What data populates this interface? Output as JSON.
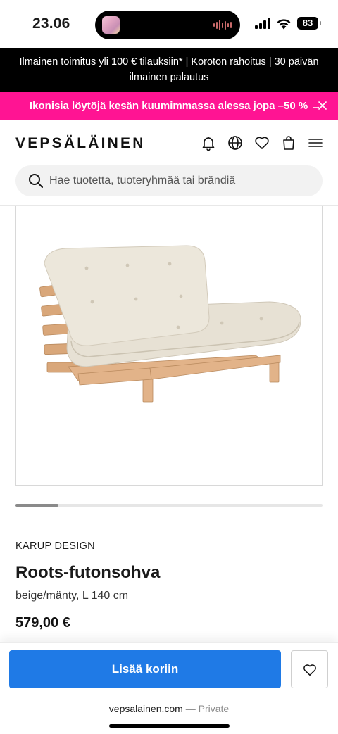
{
  "status_bar": {
    "time": "23.06",
    "battery": "83"
  },
  "promo": {
    "shipping_text": "Ilmainen toimitus yli 100 € tilauksiin* | Koroton rahoitus | 30 päivän ilmainen palautus",
    "sale_text": "Ikonisia löytöjä kesän kuumimmassa alessa jopa –50 % →",
    "sale_color": "#ff1493"
  },
  "header": {
    "logo": "VEPSÄLÄINEN",
    "icons": [
      "bell-icon",
      "globe-icon",
      "heart-icon",
      "shopping-bag-icon",
      "menu-icon"
    ],
    "search_placeholder": "Hae tuotetta, tuoteryhmää tai brändiä"
  },
  "carousel": {
    "position": 0.14
  },
  "product": {
    "brand": "KARUP DESIGN",
    "name": "Roots-futonsohva",
    "variant": "beige/mänty, L 140 cm",
    "price": "579,00 €"
  },
  "cart": {
    "add_label": "Lisää koriin",
    "accent_color": "#1f7ae6"
  },
  "browser": {
    "domain": "vepsalainen.com",
    "privacy": "— Private"
  }
}
